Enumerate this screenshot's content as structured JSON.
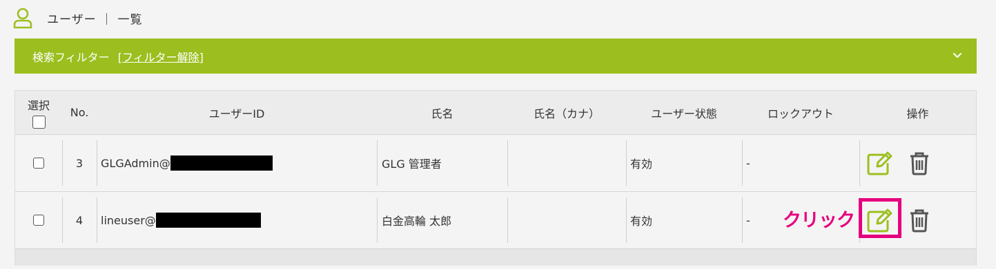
{
  "page": {
    "title": "ユーザー ｜ 一覧",
    "icon": "user-icon"
  },
  "filter": {
    "label": "検索フィルター",
    "clear_open": "[",
    "clear_text": "フィルター解除",
    "clear_close": "]",
    "icon": "chevron-down-icon"
  },
  "table": {
    "headers": {
      "select": "選択",
      "no": "No.",
      "user_id": "ユーザーID",
      "name": "氏名",
      "name_kana": "氏名（カナ）",
      "status": "ユーザー状態",
      "lockout": "ロックアウト",
      "actions": "操作"
    },
    "rows": [
      {
        "no": "3",
        "user_id": "GLGAdmin@",
        "name": "GLG 管理者",
        "name_kana": "",
        "status": "有効",
        "lockout": "-"
      },
      {
        "no": "4",
        "user_id": "lineuser@",
        "name": "白金高輪 太郎",
        "name_kana": "",
        "status": "有効",
        "lockout": "-"
      }
    ]
  },
  "annotation": {
    "click_label": "クリック",
    "color": "#e6007e"
  },
  "colors": {
    "accent": "#9cbf1f",
    "edit_icon": "#9cbf1f",
    "delete_icon": "#555555"
  },
  "icons": [
    "user-icon",
    "chevron-down-icon",
    "edit-icon",
    "trash-icon"
  ]
}
